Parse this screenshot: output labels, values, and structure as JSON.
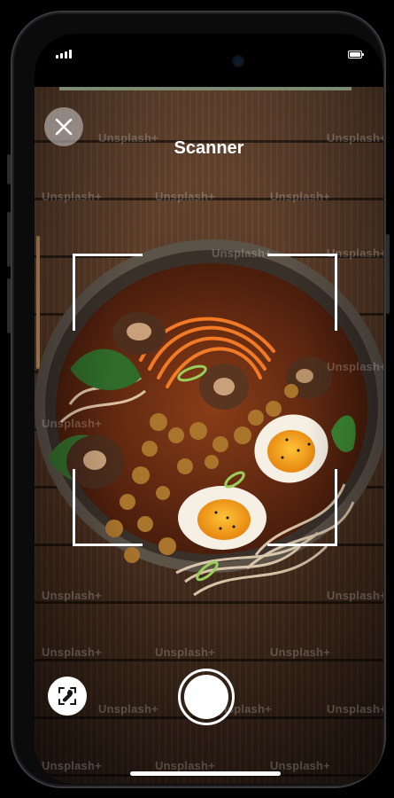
{
  "header": {
    "title": "Scanner",
    "close_icon": "close-icon"
  },
  "controls": {
    "gallery_icon": "image-scan-icon",
    "shutter": "shutter-button"
  },
  "watermark": "Unsplash+",
  "colors": {
    "accent_pill": "#7c8a72",
    "overlay_button": "#d2d2d2",
    "frame": "#ffffff"
  }
}
